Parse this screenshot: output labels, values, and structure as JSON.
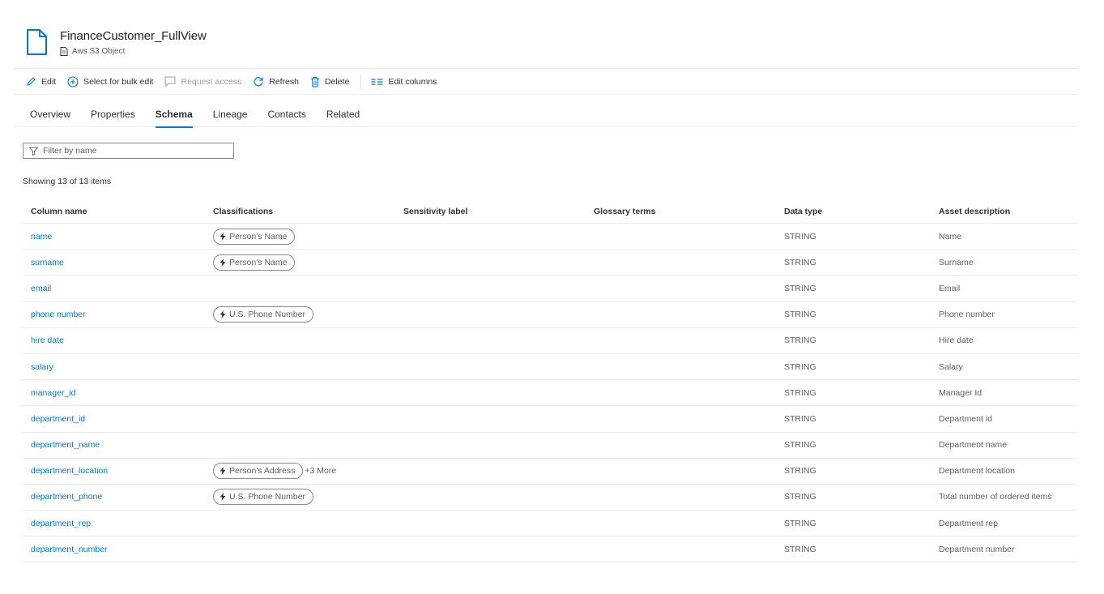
{
  "header": {
    "title": "FinanceCustomer_FullView",
    "subtitle": "Aws S3 Object",
    "icon": "file-icon",
    "subtitle_icon": "document-icon"
  },
  "toolbar": {
    "edit": "Edit",
    "bulk_edit": "Select for bulk edit",
    "request_access": "Request access",
    "refresh": "Refresh",
    "delete": "Delete",
    "edit_columns": "Edit columns"
  },
  "tabs": [
    "Overview",
    "Properties",
    "Schema",
    "Lineage",
    "Contacts",
    "Related"
  ],
  "active_tab": "Schema",
  "filter": {
    "placeholder": "Filter by name",
    "value": ""
  },
  "count_text": "Showing 13 of 13 items",
  "table": {
    "headers": [
      "Column name",
      "Classifications",
      "Sensitivity label",
      "Glossary terms",
      "Data type",
      "Asset description"
    ],
    "rows": [
      {
        "name": "name",
        "classification": "Person's Name",
        "more": "",
        "sensitivity": "",
        "glossary": "",
        "type": "STRING",
        "description": "Name"
      },
      {
        "name": "surname",
        "classification": "Person's Name",
        "more": "",
        "sensitivity": "",
        "glossary": "",
        "type": "STRING",
        "description": "Surname"
      },
      {
        "name": "email",
        "classification": "",
        "more": "",
        "sensitivity": "",
        "glossary": "",
        "type": "STRING",
        "description": "Email"
      },
      {
        "name": "phone number",
        "classification": "U.S. Phone Number",
        "more": "",
        "sensitivity": "",
        "glossary": "",
        "type": "STRING",
        "description": "Phone number"
      },
      {
        "name": "hire date",
        "classification": "",
        "more": "",
        "sensitivity": "",
        "glossary": "",
        "type": "STRING",
        "description": "Hire date"
      },
      {
        "name": "salary",
        "classification": "",
        "more": "",
        "sensitivity": "",
        "glossary": "",
        "type": "STRING",
        "description": "Salary"
      },
      {
        "name": "manager_id",
        "classification": "",
        "more": "",
        "sensitivity": "",
        "glossary": "",
        "type": "STRING",
        "description": "Manager Id"
      },
      {
        "name": "department_id",
        "classification": "",
        "more": "",
        "sensitivity": "",
        "glossary": "",
        "type": "STRING",
        "description": "Department id"
      },
      {
        "name": "department_name",
        "classification": "",
        "more": "",
        "sensitivity": "",
        "glossary": "",
        "type": "STRING",
        "description": "Department name"
      },
      {
        "name": "department_location",
        "classification": "Person's Address",
        "more": "+3 More",
        "sensitivity": "",
        "glossary": "",
        "type": "STRING",
        "description": "Department location"
      },
      {
        "name": "department_phone",
        "classification": "U.S. Phone Number",
        "more": "",
        "sensitivity": "",
        "glossary": "",
        "type": "STRING",
        "description": "Total number of ordered items"
      },
      {
        "name": "department_rep",
        "classification": "",
        "more": "",
        "sensitivity": "",
        "glossary": "",
        "type": "STRING",
        "description": "Department rep"
      },
      {
        "name": "department_number",
        "classification": "",
        "more": "",
        "sensitivity": "",
        "glossary": "",
        "type": "STRING",
        "description": "Department number"
      }
    ]
  },
  "colors": {
    "accent": "#0078d4",
    "text": "#323130",
    "muted": "#605e5c",
    "disabled": "#a19f9d"
  }
}
